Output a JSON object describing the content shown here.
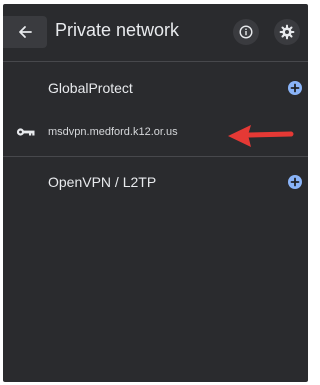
{
  "header": {
    "title": "Private network",
    "back_icon": "arrow-left-icon",
    "info_icon": "info-icon",
    "settings_icon": "gear-icon"
  },
  "sections": [
    {
      "label": "GlobalProtect",
      "add_icon": "plus-circle-icon",
      "networks": [
        {
          "name": "msdvpn.medford.k12.or.us",
          "icon": "key-icon"
        }
      ]
    },
    {
      "label": "OpenVPN / L2TP",
      "add_icon": "plus-circle-icon",
      "networks": []
    }
  ],
  "annotation": {
    "type": "arrow",
    "color": "#e53935",
    "points_to": "msdvpn.medford.k12.or.us"
  },
  "colors": {
    "background": "#2a2b2e",
    "accent": "#8ab4f8",
    "text": "#e8eaed"
  }
}
